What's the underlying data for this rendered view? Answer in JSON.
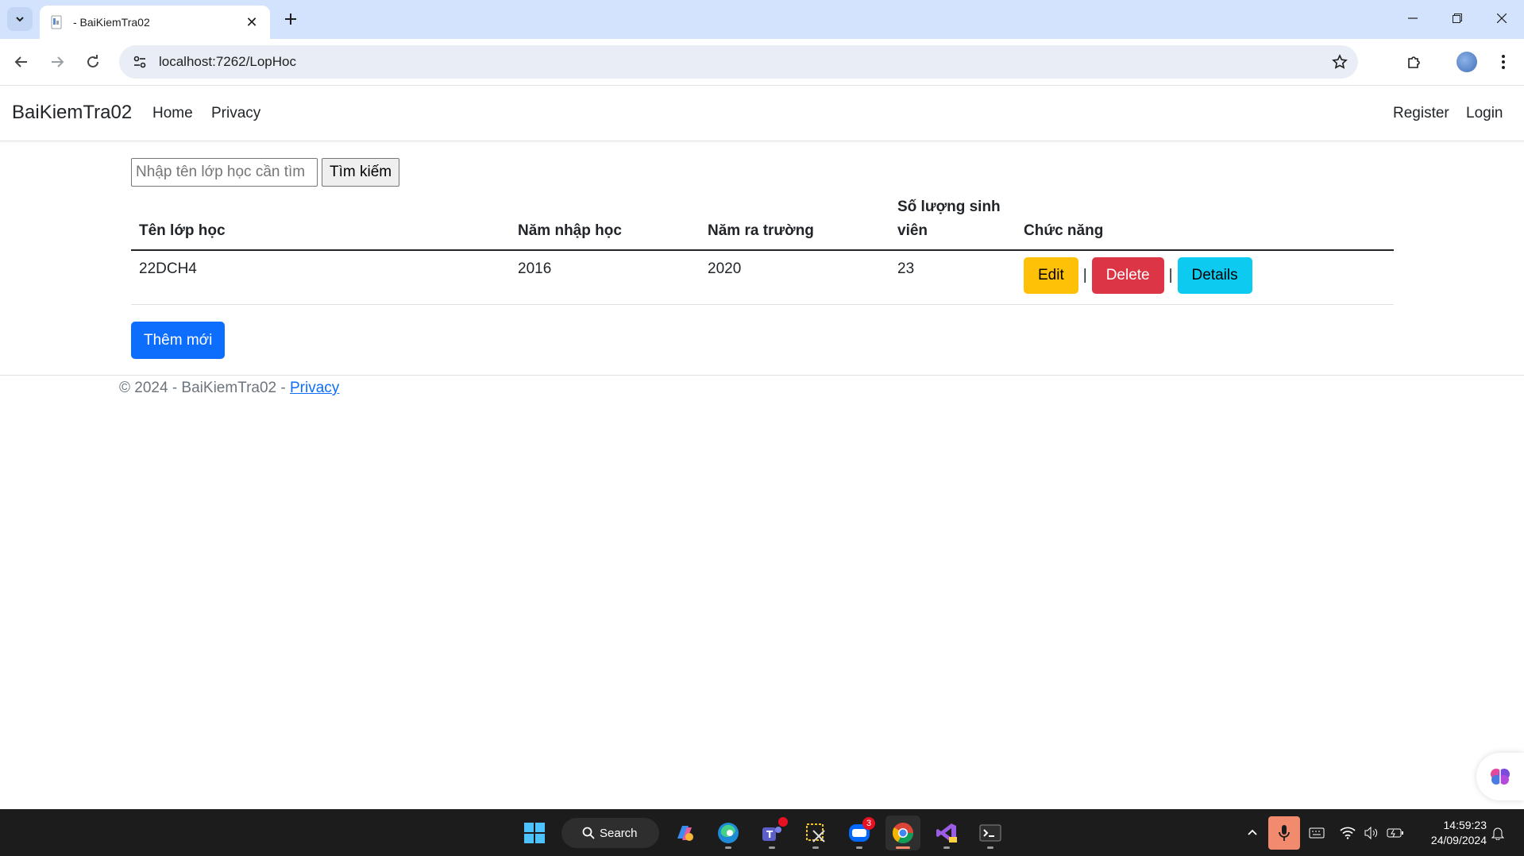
{
  "browser": {
    "tab_title": "- BaiKiemTra02",
    "url": "localhost:7262/LopHoc"
  },
  "site": {
    "brand": "BaiKiemTra02",
    "nav": {
      "home": "Home",
      "privacy": "Privacy",
      "register": "Register",
      "login": "Login"
    }
  },
  "search": {
    "placeholder": "Nhập tên lớp học cần tìm",
    "button": "Tìm kiếm"
  },
  "table": {
    "headers": [
      "Tên lớp học",
      "Năm nhập học",
      "Năm ra trường",
      "Số lượng sinh viên",
      "Chức năng"
    ],
    "rows": [
      {
        "name": "22DCH4",
        "start": "2016",
        "end": "2020",
        "count": "23"
      }
    ],
    "actions": {
      "edit": "Edit",
      "delete": "Delete",
      "details": "Details",
      "separator": "|"
    }
  },
  "add_button": "Thêm mới",
  "footer": {
    "text": "© 2024 - BaiKiemTra02 - ",
    "link": "Privacy"
  },
  "taskbar": {
    "search_label": "Search",
    "zalo_badge": "3",
    "time": "14:59:23",
    "date": "24/09/2024"
  },
  "colors": {
    "edit": "#ffc107",
    "delete": "#dc3545",
    "details": "#0dcaf0",
    "primary": "#0d6efd",
    "tabbar": "#d3e3fd"
  }
}
